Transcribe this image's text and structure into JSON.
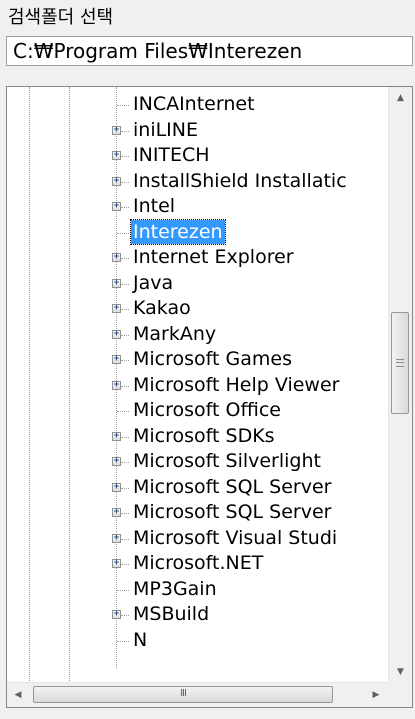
{
  "panel": {
    "label": "검색폴더 선택",
    "path_value": "C:₩Program Files₩Interezen"
  },
  "tree": {
    "items": [
      {
        "label": "INCAInternet",
        "expandable": false,
        "selected": false
      },
      {
        "label": "iniLINE",
        "expandable": true,
        "selected": false
      },
      {
        "label": "INITECH",
        "expandable": true,
        "selected": false
      },
      {
        "label": "InstallShield Installatic",
        "expandable": true,
        "selected": false
      },
      {
        "label": "Intel",
        "expandable": true,
        "selected": false
      },
      {
        "label": "Interezen",
        "expandable": false,
        "selected": true
      },
      {
        "label": "Internet Explorer",
        "expandable": true,
        "selected": false
      },
      {
        "label": "Java",
        "expandable": true,
        "selected": false
      },
      {
        "label": "Kakao",
        "expandable": true,
        "selected": false
      },
      {
        "label": "MarkAny",
        "expandable": true,
        "selected": false
      },
      {
        "label": "Microsoft Games",
        "expandable": true,
        "selected": false
      },
      {
        "label": "Microsoft Help Viewer",
        "expandable": true,
        "selected": false
      },
      {
        "label": "Microsoft Office",
        "expandable": false,
        "selected": false
      },
      {
        "label": "Microsoft SDKs",
        "expandable": true,
        "selected": false
      },
      {
        "label": "Microsoft Silverlight",
        "expandable": true,
        "selected": false
      },
      {
        "label": "Microsoft SQL Server",
        "expandable": true,
        "selected": false
      },
      {
        "label": "Microsoft SQL Server",
        "expandable": true,
        "selected": false
      },
      {
        "label": "Microsoft Visual Studi",
        "expandable": true,
        "selected": false
      },
      {
        "label": "Microsoft.NET",
        "expandable": true,
        "selected": false
      },
      {
        "label": "MP3Gain",
        "expandable": false,
        "selected": false
      },
      {
        "label": "MSBuild",
        "expandable": true,
        "selected": false
      },
      {
        "label": "N",
        "expandable": false,
        "selected": false
      }
    ]
  },
  "scrollbars": {
    "expander_glyph": "+",
    "vertical_up_glyph": "▲",
    "vertical_down_glyph": "▼",
    "horizontal_left_glyph": "◀",
    "horizontal_right_glyph": "▶",
    "horizontal_thumb_grip": "III",
    "vertical_position": 0.45
  }
}
